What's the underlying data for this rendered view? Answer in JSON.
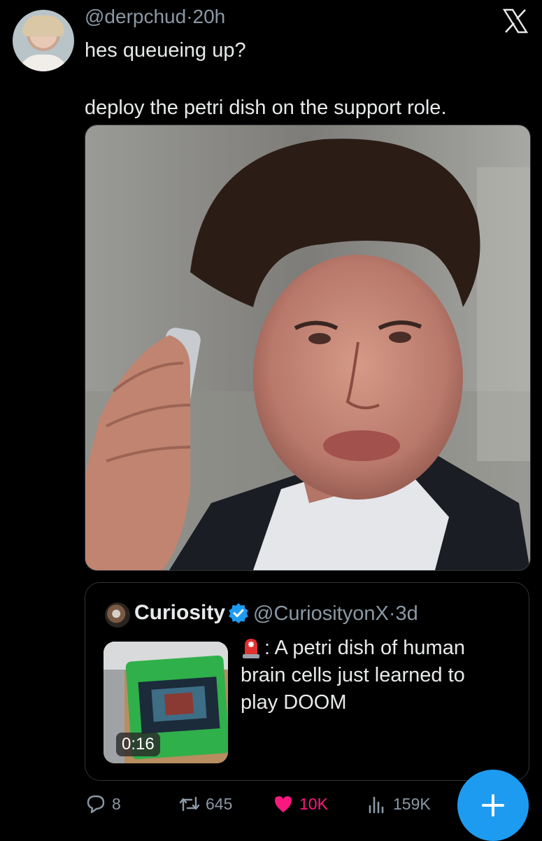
{
  "tweet": {
    "handle": "@derpchud",
    "separator": "·",
    "time": "20h",
    "text_line1": "hes queueing up?",
    "text_line2": "deploy the petri dish on the support role."
  },
  "quote": {
    "name": "Curiosity",
    "handle": "@CuriosityonX",
    "separator": "·",
    "time": "3d",
    "text": ": A petri dish of human brain cells just learned to play DOOM",
    "video_duration": "0:16",
    "thumb_icon": "siren-emoji"
  },
  "actions": {
    "replies": "8",
    "reposts": "645",
    "likes": "10K",
    "views": "159K"
  },
  "colors": {
    "background": "#000000",
    "text": "#e7e9ea",
    "secondary": "#8b98a5",
    "like": "#f91880",
    "accent": "#1d9bf0"
  },
  "icons": [
    "x-logo-icon",
    "verified-icon",
    "reply-icon",
    "repost-icon",
    "heart-icon",
    "views-icon",
    "plus-icon"
  ]
}
